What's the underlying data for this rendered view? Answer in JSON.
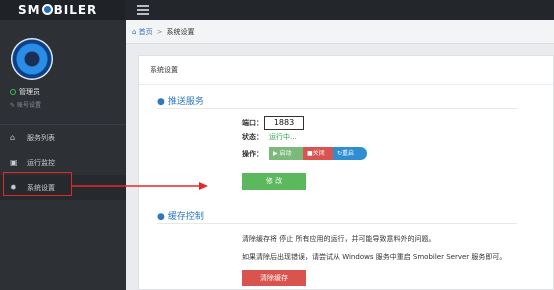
{
  "brand": {
    "text_before": "SM",
    "text_after": "BILER"
  },
  "user": {
    "name": "管理员",
    "settings": "账号设置"
  },
  "nav": [
    {
      "icon": "home-icon",
      "label": "服务列表"
    },
    {
      "icon": "document-icon",
      "label": "运行监控"
    },
    {
      "icon": "gear-icon",
      "label": "系统设置"
    }
  ],
  "breadcrumb": {
    "home": "首页",
    "separator": ">",
    "current": "系统设置"
  },
  "panel": {
    "title": "系统设置",
    "service": {
      "title": "推送服务",
      "port_label": "端口：",
      "port_value": "1883",
      "status_label": "状态：",
      "status_value": "运行中...",
      "action_label": "操作：",
      "start_label": "启动",
      "close_label": "关闭",
      "restart_label": "重启",
      "modify_label": "修 改"
    },
    "cache": {
      "title": "缓存控制",
      "line1": "清除缓存将 停止 所有应用的运行，并可能导致意料外的问题。",
      "line2": "如果清除后出现错误，请尝试从 Windows 服务中重启 Smobiler Server 服务即可。",
      "clear_label": "清除缓存"
    }
  },
  "colors": {
    "accent_blue": "#2f78bd",
    "green": "#5cb85c",
    "red": "#d9534f",
    "highlight": "#e02a2a"
  }
}
